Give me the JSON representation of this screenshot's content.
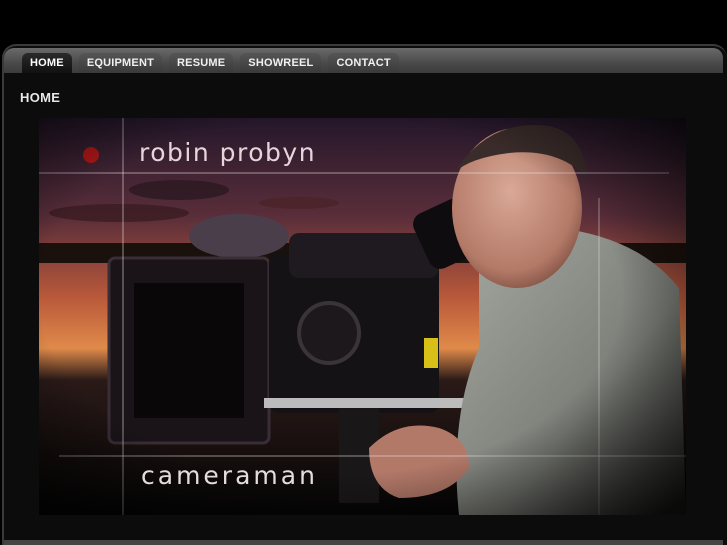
{
  "nav": {
    "tabs": [
      {
        "label": "HOME",
        "active": true
      },
      {
        "label": "EQUIPMENT",
        "active": false
      },
      {
        "label": "RESUME",
        "active": false
      },
      {
        "label": "SHOWREEL",
        "active": false
      },
      {
        "label": "CONTACT",
        "active": false
      }
    ]
  },
  "page": {
    "heading": "HOME"
  },
  "hero": {
    "title": "robin probyn",
    "subtitle": "cameraman",
    "colors": {
      "record_dot": "#b01818",
      "sky_top": "#2a1a2e",
      "sky_glow": "#d06a3a",
      "jacket": "#8a8c86"
    }
  }
}
